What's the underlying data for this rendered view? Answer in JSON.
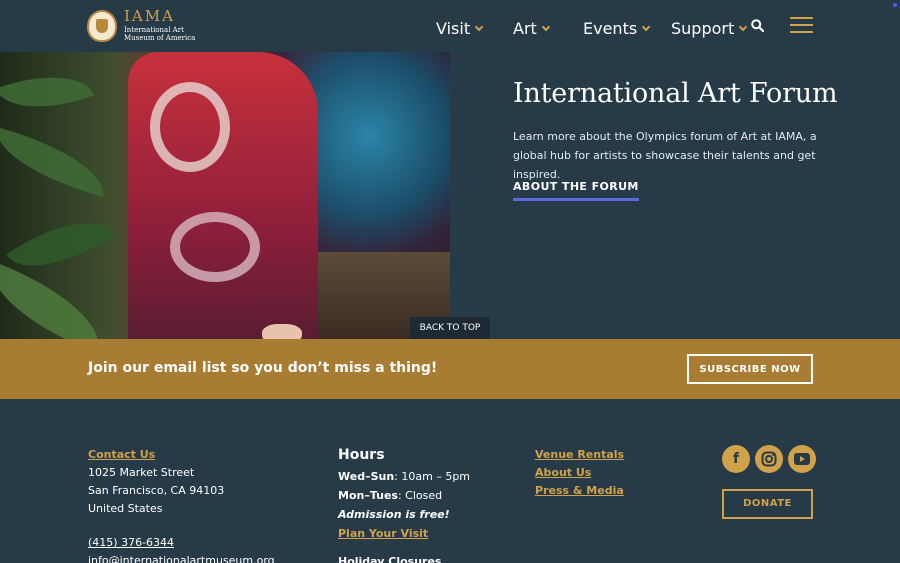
{
  "brand": {
    "name": "IAMA",
    "line1": "International Art",
    "line2": "Museum of America"
  },
  "nav": {
    "items": [
      {
        "label": "Visit"
      },
      {
        "label": "Art"
      },
      {
        "label": "Events"
      },
      {
        "label": "Support"
      }
    ],
    "icons": [
      "search-icon",
      "menu-icon",
      "chevron-down-icon"
    ]
  },
  "hero": {
    "title": "International Art Forum",
    "description": "Learn more about the Olympics forum of Art at IAMA, a global hub for artists to showcase their talents and get inspired.",
    "link": "ABOUT THE FORUM",
    "back_to_top": "BACK TO TOP"
  },
  "email_band": {
    "text": "Join our email list so you don’t miss a thing!",
    "button": "SUBSCRIBE NOW"
  },
  "footer": {
    "contact": {
      "title": "Contact Us",
      "street": "1025 Market Street",
      "city": "San Francisco, CA 94103",
      "country": "United States",
      "phone": "(415) 376-6344",
      "email": "info@internationalartmuseum.org"
    },
    "hours": {
      "title": "Hours",
      "wed_sun_label": "Wed–Sun",
      "wed_sun_value": ": 10am – 5pm",
      "mon_tue_label": "Mon–Tues",
      "mon_tue_value": ": Closed",
      "admission": "Admission is free!",
      "plan": "Plan Your Visit",
      "holiday": "Holiday Closures"
    },
    "links": [
      {
        "label": "Venue Rentals"
      },
      {
        "label": "About Us"
      },
      {
        "label": "Press & Media"
      }
    ],
    "social": [
      "facebook-icon",
      "instagram-icon",
      "youtube-icon"
    ],
    "donate": "DONATE"
  },
  "colors": {
    "background": "#263a47",
    "gold": "#d0a24a",
    "band": "#a97c33",
    "accent_underline": "#5a6bdc"
  }
}
